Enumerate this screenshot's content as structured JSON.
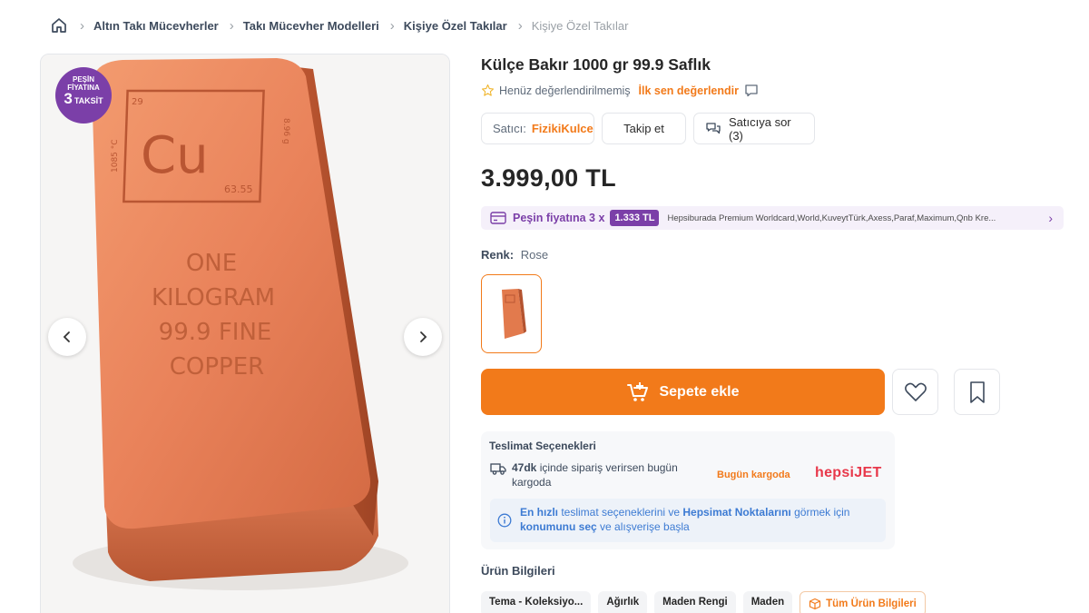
{
  "breadcrumb": {
    "items": [
      "Altın Takı Mücevherler",
      "Takı Mücevher Modelleri",
      "Kişiye Özel Takılar"
    ],
    "current": "Kişiye Özel Takılar"
  },
  "gallery": {
    "badge": {
      "line1": "PEŞİN",
      "line2": "FİYATINA",
      "number": "3",
      "line3": "TAKSİT"
    },
    "image": {
      "symbol": "Cu",
      "atomic_number": "29",
      "atomic_mass": "63.55",
      "side_left": "1085 °C",
      "side_right": "8.96 g",
      "engraving": [
        "ONE",
        "KILOGRAM",
        "99.9 FINE",
        "COPPER"
      ]
    },
    "prev_icon": "chevron-left-icon",
    "next_icon": "chevron-right-icon"
  },
  "product": {
    "title": "Külçe Bakır 1000 gr 99.9 Saflık",
    "rating_text": "Henüz değerlendirilmemiş",
    "rate_link": "İlk sen değerlendir",
    "seller_label": "Satıcı:",
    "seller_name": "FizikiKulce",
    "follow_label": "Takip et",
    "ask_label": "Satıcıya sor (3)",
    "price": "3.999,00 TL",
    "installment": {
      "label": "Peşin fiyatına 3 x",
      "amount": "1.333 TL",
      "banks": "Hepsiburada Premium Worldcard,World,KuveytTürk,Axess,Paraf,Maximum,Qnb Kre..."
    },
    "color_label": "Renk:",
    "color_value": "Rose",
    "add_to_cart": "Sepete ekle"
  },
  "delivery": {
    "title": "Teslimat Seçenekleri",
    "time": "47dk",
    "text": "içinde sipariş verirsen bugün kargoda",
    "today_label": "Bugün kargoda",
    "brand_hepsi": "hepsi",
    "brand_jet": "JET",
    "info_bold1": "En hızlı",
    "info_text1": " teslimat seçeneklerini ve ",
    "info_bold2": "Hepsimat Noktalarını",
    "info_text2": " görmek için ",
    "info_bold3": "konumunu seç",
    "info_text3": " ve alışverişe başla"
  },
  "specs": {
    "title": "Ürün Bilgileri",
    "tabs": [
      "Tema - Koleksiyo...",
      "Ağırlık",
      "Maden Rengi",
      "Maden"
    ],
    "all_label": "Tüm Ürün Bilgileri"
  },
  "colors": {
    "accent_orange": "#f27a1a",
    "purple": "#7b3fa8",
    "info_blue": "#3d7bd3",
    "copper": "#e27a4d"
  }
}
